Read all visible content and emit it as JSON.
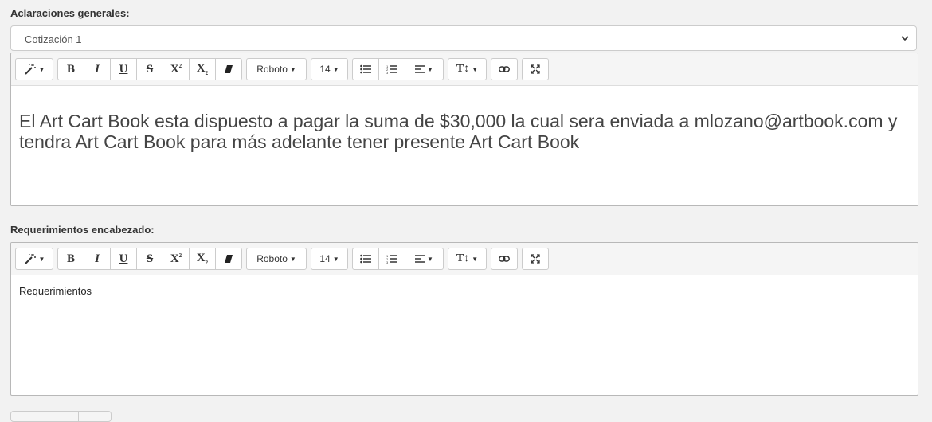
{
  "general": {
    "label": "Aclaraciones generales:",
    "select_value": "Cotización 1"
  },
  "toolbar": {
    "font_name": "Roboto",
    "font_size": "14"
  },
  "editor1": {
    "text": "El Art Cart Book esta dispuesto a pagar la suma de $30,000 la cual sera enviada a mlozano@artbook.com y tendra Art Cart Book para más adelante tener presente Art Cart Book"
  },
  "requirements": {
    "label": "Requerimientos encabezado:",
    "text": "Requerimientos"
  }
}
